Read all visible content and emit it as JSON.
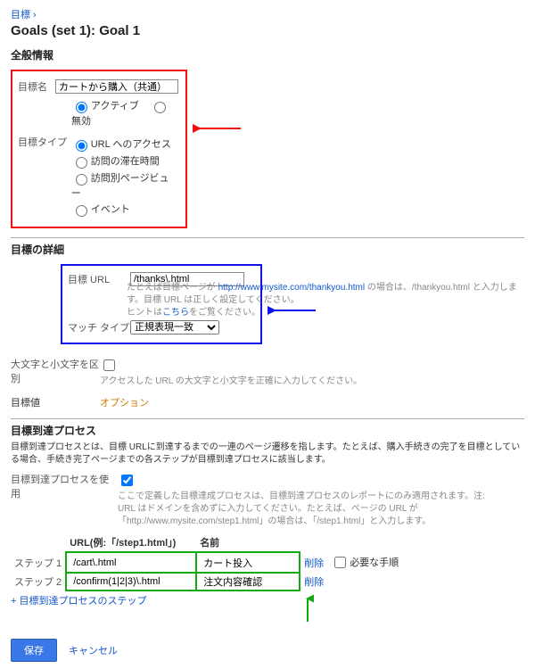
{
  "crumb": "目標 ›",
  "title": "Goals (set 1): Goal 1",
  "general": {
    "heading": "全般情報",
    "name_label": "目標名",
    "name_value": "カートから購入（共通）",
    "status_active": "アクティブ",
    "status_inactive": "無効",
    "type_label": "目標タイプ",
    "type_url": "URL へのアクセス",
    "type_time": "訪問の滞在時間",
    "type_pv": "訪問別ページビュー",
    "type_event": "イベント"
  },
  "details": {
    "heading": "目標の詳細",
    "url_label": "目標 URL",
    "url_value": "/thanks\\.html",
    "hint_a": "たとえば目標ページが",
    "hint_link": "http://www.mysite.com/thankyou.html",
    "hint_b": " の場合は、/thankyou.html と入力します。目標 URL は正しく設定してください。",
    "hint_c": "ヒントは",
    "hint_here": "こちら",
    "hint_d": "をご覧ください。",
    "match_label": "マッチ タイプ",
    "match_value": "正規表現一致",
    "case_label": "大文字と小文字を区別",
    "case_hint": "アクセスした URL の大文字と小文字を正確に入力してください。",
    "value_label": "目標値",
    "value_option": "オプション"
  },
  "funnel": {
    "heading": "目標到達プロセス",
    "desc": "目標到達プロセスとは、目標 URLに到達するまでの一連のページ遷移を指します。たとえば、購入手続きの完了を目標としている場合、手続き完了ページまでの各ステップが目標到達プロセスに該当します。",
    "use_label": "目標到達プロセスを使用",
    "use_hint": "ここで定義した目標達成プロセスは、目標到達プロセスのレポートにのみ適用されます。注: URL はドメインを含めずに入力してください。たとえば、ページの URL が「http://www.mysite.com/step1.html」の場合は、「/step1.html」と入力します。",
    "col_url": "URL(例:「/step1.html」)",
    "col_name": "名前",
    "step1_label": "ステップ 1",
    "step1_url": "/cart\\.html",
    "step1_name": "カート投入",
    "step2_label": "ステップ 2",
    "step2_url": "/confirm(1|2|3)\\.html",
    "step2_name": "注文内容確認",
    "remove": "削除",
    "required": "必要な手順",
    "add_step": "+ 目標到達プロセスのステップ"
  },
  "buttons": {
    "save": "保存",
    "cancel": "キャンセル"
  }
}
